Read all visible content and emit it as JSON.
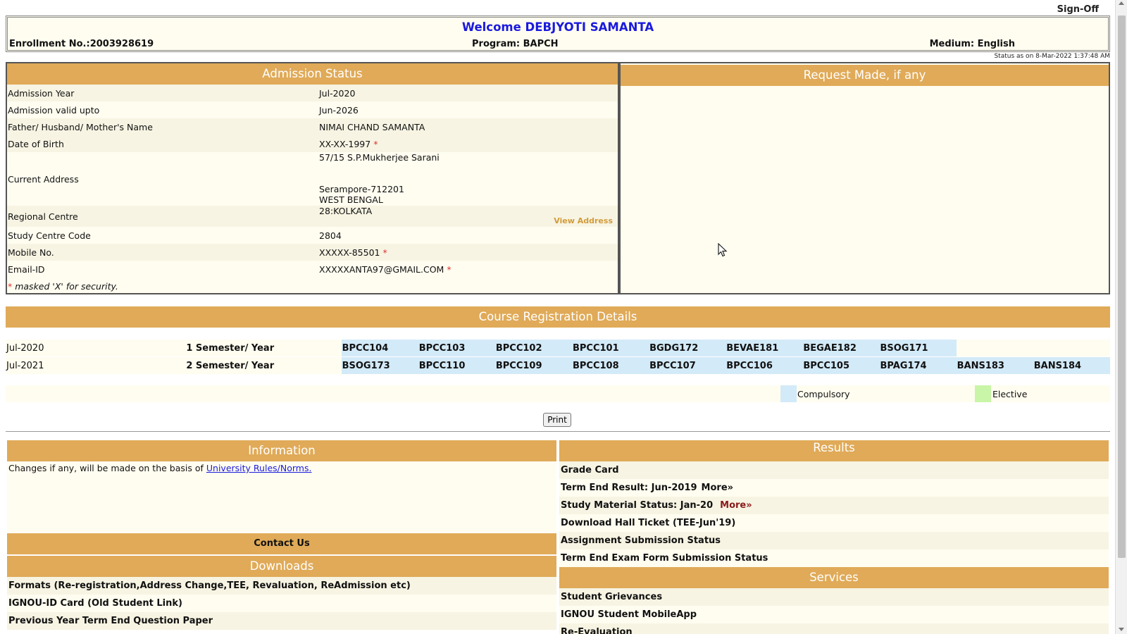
{
  "header": {
    "signoff": "Sign-Off",
    "welcome": "Welcome DEBJYOTI SAMANTA",
    "enrollment": "Enrollment No.:2003928619",
    "program": "Program: BAPCH",
    "medium": "Medium: English",
    "status_as_on": "Status as on 8-Mar-2022 1:37:48 AM"
  },
  "admission": {
    "title": "Admission Status",
    "rows": [
      {
        "label": "Admission Year",
        "value": "Jul-2020"
      },
      {
        "label": "Admission valid upto",
        "value": "Jun-2026"
      },
      {
        "label": "Father/ Husband/ Mother's Name",
        "value": "NIMAI CHAND SAMANTA"
      },
      {
        "label": "Date of Birth",
        "value": "XX-XX-1997"
      },
      {
        "label": "Current Address",
        "address_line1": "57/15 S.P.Mukherjee Sarani",
        "address_line2": "Serampore-712201",
        "address_line3": "WEST BENGAL"
      },
      {
        "label": "Regional Centre",
        "value": "28:KOLKATA",
        "link": "View Address"
      },
      {
        "label": "Study Centre Code",
        "value": "2804"
      },
      {
        "label": "Mobile No.",
        "value": "XXXXX-85501"
      },
      {
        "label": "Email-ID",
        "value": "XXXXXANTA97@GMAIL.COM"
      }
    ],
    "star": "*",
    "masked_note": " masked 'X' for security."
  },
  "request": {
    "title": "Request Made, if any"
  },
  "course_registration": {
    "title": "Course Registration Details",
    "rows": [
      {
        "year": "Jul-2020",
        "semester": "1 Semester/ Year",
        "codes": [
          "BPCC104",
          "BPCC103",
          "BPCC102",
          "BPCC101",
          "BGDG172",
          "BEVAE181",
          "BEGAE182",
          "BSOG171"
        ]
      },
      {
        "year": "Jul-2021",
        "semester": "2 Semester/ Year",
        "codes": [
          "BSOG173",
          "BPCC110",
          "BPCC109",
          "BPCC108",
          "BPCC107",
          "BPCC106",
          "BPCC105",
          "BPAG174",
          "BANS183",
          "BANS184"
        ]
      }
    ],
    "legend": {
      "compulsory": "Compulsory",
      "elective": "Elective",
      "compulsory_color": "#d3eaf8",
      "elective_color": "#c8f5a8"
    }
  },
  "print_label": "Print",
  "information": {
    "title": "Information",
    "text": "Changes if any, will be made on the basis of ",
    "link": "University Rules/Norms."
  },
  "contact": "Contact Us",
  "downloads": {
    "title": "Downloads",
    "items": [
      "Formats (Re-registration,Address Change,TEE, Revaluation, ReAdmission etc)",
      "IGNOU-ID Card (Old Student Link)",
      "Previous Year Term End Question Paper"
    ]
  },
  "results": {
    "title": "Results",
    "grade_card": "Grade Card",
    "term_end": "Term End Result: Jun-2019",
    "term_end_more": "More»",
    "study_material": "Study Material Status: Jan-20",
    "study_material_more": "More»",
    "hall_ticket": "Download Hall Ticket (TEE-Jun'19)",
    "assignment": "Assignment Submission Status",
    "exam_form": "Term End Exam Form Submission Status"
  },
  "services": {
    "title": "Services",
    "items": [
      "Student Grievances",
      "IGNOU Student MobileApp",
      "Re-Evaluation"
    ]
  },
  "colors": {
    "header_bg": "#e0aa58",
    "panel_bg": "#fffdf0",
    "welcome_text": "#1a1add"
  }
}
